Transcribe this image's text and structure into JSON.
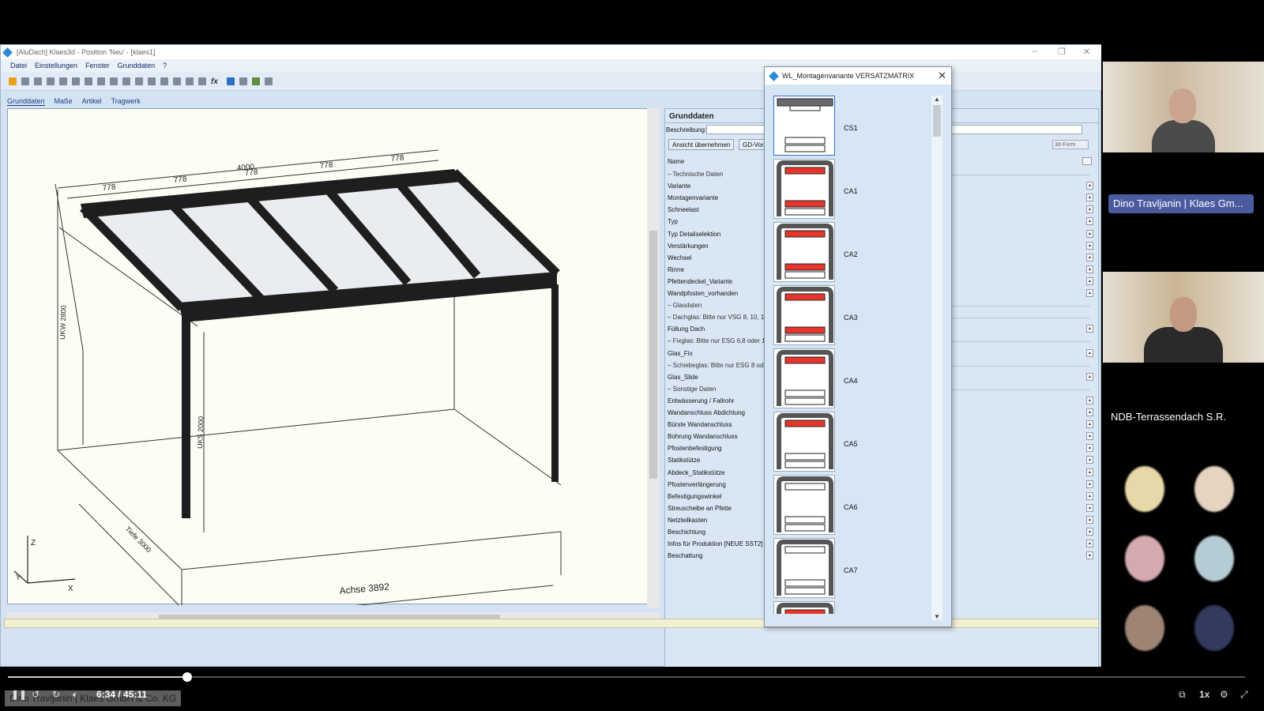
{
  "window": {
    "title": "[AluDach] Klaes3d - Position 'Neu' - [klaes1]"
  },
  "menu": [
    "Datei",
    "Einstellungen",
    "Fenster",
    "Grunddaten",
    "?"
  ],
  "subtabs": [
    "Grunddaten",
    "Maße",
    "Artikel",
    "Tragwerk"
  ],
  "toolbar": {
    "fx_label": "fx"
  },
  "viewport": {
    "dim_total": "4000",
    "dim_seg": "778",
    "dim_height_left": "UKW 2800",
    "dim_height_post": "UKS 2000",
    "dim_depth": "Tiefe 3000",
    "dim_axis": "Achse 3892",
    "axis_z": "Z",
    "axis_x": "X",
    "axis_y": "Y"
  },
  "props": {
    "title": "Grunddaten",
    "beschreibung_label": "Beschreibung:",
    "btn_ansicht": "Ansicht übernehmen",
    "btn_gd": "GD-Vor",
    "form_value": "3d-Form",
    "col_name": "Name",
    "rows": [
      {
        "t": "sec",
        "label": "Technische Daten"
      },
      {
        "t": "row",
        "label": "Variante"
      },
      {
        "t": "row",
        "label": "Montagenvariante"
      },
      {
        "t": "row",
        "label": "Schneelast"
      },
      {
        "t": "row",
        "label": "Typ"
      },
      {
        "t": "row",
        "label": "Typ Detailselektion"
      },
      {
        "t": "row",
        "label": "Verstärkungen"
      },
      {
        "t": "row",
        "label": "Wechsel"
      },
      {
        "t": "row",
        "label": "Rinne"
      },
      {
        "t": "row",
        "label": "Pfettendeckel_Variante"
      },
      {
        "t": "row",
        "label": "Wandpfosten_vorhanden"
      },
      {
        "t": "sec",
        "label": "Glasdaten"
      },
      {
        "t": "sec",
        "label": "Dachglas: Bitte nur VSG 8, 10, 12"
      },
      {
        "t": "row",
        "label": "Füllung Dach"
      },
      {
        "t": "sec",
        "label": "Fixglas: Bitte nur ESG 6,8 oder 10"
      },
      {
        "t": "row",
        "label": "Glas_Fix"
      },
      {
        "t": "sec",
        "label": "Schiebeglas: Bitte nur ESG 8 oder"
      },
      {
        "t": "row",
        "label": "Glas_Slide"
      },
      {
        "t": "sec",
        "label": "Sonstige Daten"
      },
      {
        "t": "row",
        "label": "Entwässerung / Fallrohr"
      },
      {
        "t": "row",
        "label": "Wandanschluss Abdichtung"
      },
      {
        "t": "row",
        "label": "Bürste Wandanschluss"
      },
      {
        "t": "row",
        "label": "Bohrung Wandanschluss"
      },
      {
        "t": "row",
        "label": "Pfostenbefestigung"
      },
      {
        "t": "row",
        "label": "Statikstütze"
      },
      {
        "t": "row",
        "label": "Abdeck_Statikstütze"
      },
      {
        "t": "row",
        "label": "Pfostenverlängerung"
      },
      {
        "t": "row",
        "label": "Befestigungswinkel"
      },
      {
        "t": "row",
        "label": "Streuscheibe an Pfette"
      },
      {
        "t": "row",
        "label": "Netzteilkasten"
      },
      {
        "t": "row",
        "label": "Beschichtung"
      },
      {
        "t": "row",
        "label": "Infos für Produktion [NEUE SST2]"
      },
      {
        "t": "row",
        "label": "Beschattung"
      }
    ]
  },
  "dialog": {
    "title": "WL_Montagenvariante VERSATZMATRIX",
    "close": "✕",
    "items": [
      "CS1",
      "CA1",
      "CA2",
      "CA3",
      "CA4",
      "CA5",
      "CA6",
      "CA7"
    ]
  },
  "participants": {
    "name1": "Dino Travljanin | Klaes Gm...",
    "group": "NDB-Terrassendach S.R."
  },
  "player": {
    "time": "6:34 / 45:11",
    "speed": "1x",
    "caption": "Dino Travljanin | Klaes GmbH & Co. KG",
    "progress": 0.145
  },
  "colors": {
    "accent_red": "#e8352b",
    "frame": "#222222"
  }
}
